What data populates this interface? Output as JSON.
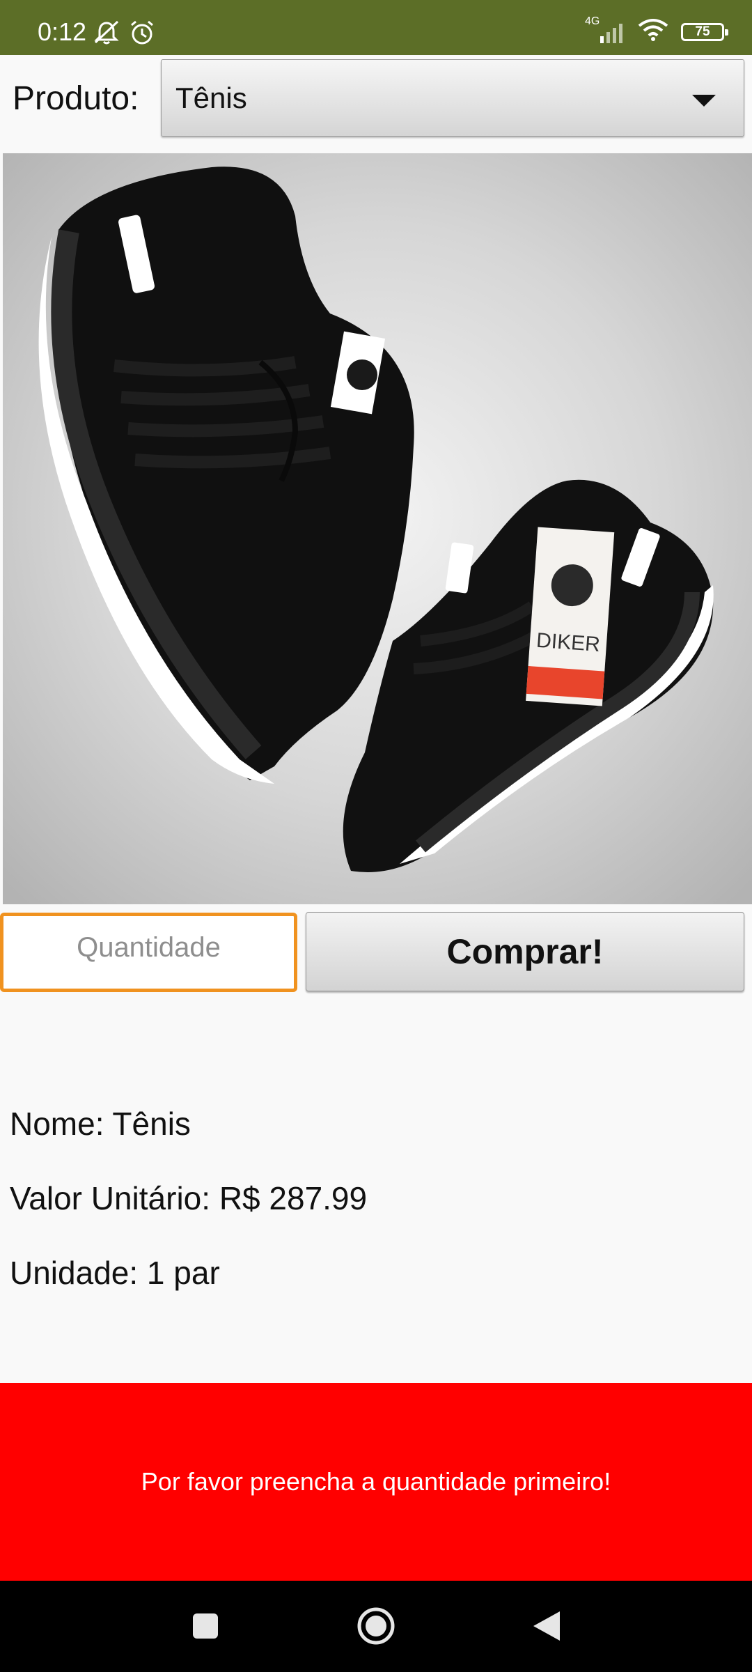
{
  "status_bar": {
    "time": "0:12",
    "network": "4G",
    "battery": "75",
    "icons": [
      "notifications-off-icon",
      "alarm-icon",
      "signal-icon",
      "wifi-icon",
      "battery-icon"
    ]
  },
  "product": {
    "label": "Produto:",
    "selected": "Tênis",
    "image_icon": "sneaker-photo",
    "image_brand": "DIKER"
  },
  "order": {
    "quantity_value": "",
    "quantity_placeholder": "Quantidade",
    "buy_label": "Comprar!"
  },
  "details": {
    "name": "Nome: Tênis",
    "unit_price": "Valor Unitário: R$ 287.99",
    "unit": "Unidade: 1 par"
  },
  "alert": {
    "message": "Por favor preencha a quantidade primeiro!"
  },
  "navigation": {
    "icons": [
      "recents-icon",
      "home-icon",
      "back-icon"
    ]
  },
  "colors": {
    "status_bar": "#5c6e27",
    "alert_bg": "#ff0000",
    "input_focus_border": "#f0921f"
  }
}
